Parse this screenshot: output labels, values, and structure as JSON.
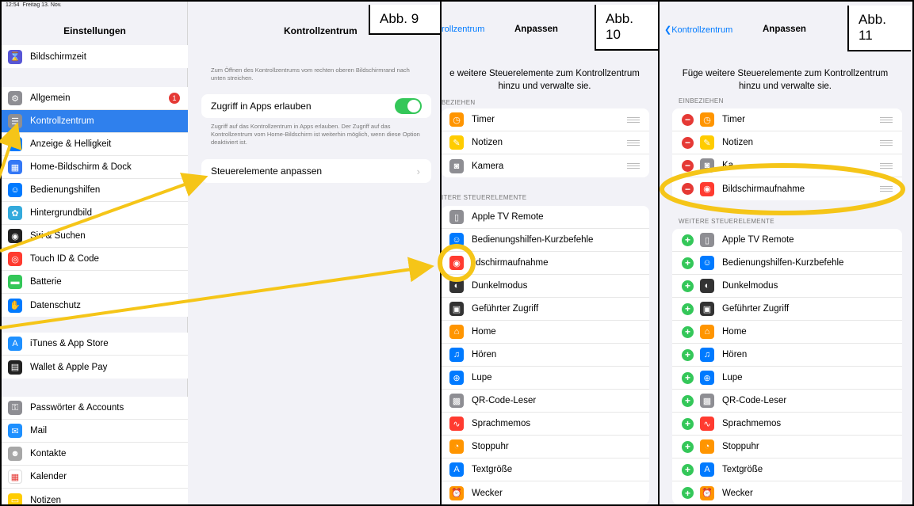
{
  "panel1": {
    "label": "Abb. 9",
    "status_time": "12:54",
    "status_date": "Freitag 13. Nov.",
    "sidebar_title": "Einstellungen",
    "groups": [
      [
        {
          "label": "Bildschirmzeit",
          "icon": "hourglass-icon",
          "color": "#5856d6",
          "glyph": "⌛"
        }
      ],
      [
        {
          "label": "Allgemein",
          "icon": "gear-icon",
          "color": "#8e8e93",
          "glyph": "⚙",
          "badge": "1"
        },
        {
          "label": "Kontrollzentrum",
          "icon": "switches-icon",
          "color": "#8e8e93",
          "glyph": "☰",
          "selected": true
        },
        {
          "label": "Anzeige & Helligkeit",
          "icon": "text-size-icon",
          "color": "#007aff",
          "glyph": "A"
        },
        {
          "label": "Home-Bildschirm & Dock",
          "icon": "grid-icon",
          "color": "#3478f6",
          "glyph": "▦"
        },
        {
          "label": "Bedienungshilfen",
          "icon": "accessibility-icon",
          "color": "#007aff",
          "glyph": "☺"
        },
        {
          "label": "Hintergrundbild",
          "icon": "flower-icon",
          "color": "#34aadc",
          "glyph": "✿"
        },
        {
          "label": "Siri & Suchen",
          "icon": "siri-icon",
          "color": "#222222",
          "glyph": "◉"
        },
        {
          "label": "Touch ID & Code",
          "icon": "fingerprint-icon",
          "color": "#ff3b30",
          "glyph": "◎"
        },
        {
          "label": "Batterie",
          "icon": "battery-icon",
          "color": "#34c759",
          "glyph": "▬"
        },
        {
          "label": "Datenschutz",
          "icon": "hand-icon",
          "color": "#007aff",
          "glyph": "✋"
        }
      ],
      [
        {
          "label": "iTunes & App Store",
          "icon": "app-store-icon",
          "color": "#1e90ff",
          "glyph": "A"
        },
        {
          "label": "Wallet & Apple Pay",
          "icon": "wallet-icon",
          "color": "#222222",
          "glyph": "▤"
        }
      ],
      [
        {
          "label": "Passwörter & Accounts",
          "icon": "key-icon",
          "color": "#8e8e93",
          "glyph": "⚿"
        },
        {
          "label": "Mail",
          "icon": "mail-icon",
          "color": "#1e90ff",
          "glyph": "✉"
        },
        {
          "label": "Kontakte",
          "icon": "contacts-icon",
          "color": "#a7a7a7",
          "glyph": "☻"
        },
        {
          "label": "Kalender",
          "icon": "calendar-icon",
          "color": "#ffffff",
          "glyph": "▦"
        },
        {
          "label": "Notizen",
          "icon": "notes-icon",
          "color": "#ffcc00",
          "glyph": "▭"
        }
      ]
    ],
    "detail": {
      "title": "Kontrollzentrum",
      "hint1": "Zum Öffnen des Kontrollzentrums vom rechten oberen Bildschirmrand nach unten streichen.",
      "toggle_label": "Zugriff in Apps erlauben",
      "toggle_on": true,
      "hint2": "Zugriff auf das Kontrollzentrum in Apps erlauben. Der Zugriff auf das Kontrollzentrum vom Home-Bildschirm ist weiterhin möglich, wenn diese Option deaktiviert ist.",
      "customize_label": "Steuerelemente anpassen"
    }
  },
  "panel2": {
    "label": "Abb. 10",
    "back": "rollzentrum",
    "title": "Anpassen",
    "intro": "e weitere Steuerelemente zum Kontrollzentrum\nhinzu und verwalte sie.",
    "section_included": "BEZIEHEN",
    "included": [
      {
        "label": "Timer",
        "icon": "timer-icon",
        "color": "#ff9500",
        "glyph": "◷"
      },
      {
        "label": "Notizen",
        "icon": "notes-icon",
        "color": "#ffcc00",
        "glyph": "✎"
      },
      {
        "label": "Kamera",
        "icon": "camera-icon",
        "color": "#8e8e93",
        "glyph": "◙"
      }
    ],
    "section_more": "ITERE STEUERELEMENTE",
    "more": [
      {
        "label": "Apple TV Remote",
        "icon": "remote-icon",
        "color": "#8e8e93",
        "glyph": "▯"
      },
      {
        "label": "Bedienungshilfen-Kurzbefehle",
        "icon": "accessibility-icon",
        "color": "#007aff",
        "glyph": "☺"
      },
      {
        "label": "ildschirmaufnahme",
        "icon": "screen-record-icon",
        "color": "#ff3b30",
        "glyph": "◉"
      },
      {
        "label": "Dunkelmodus",
        "icon": "dark-mode-icon",
        "color": "#333333",
        "glyph": "◐"
      },
      {
        "label": "Geführter Zugriff",
        "icon": "lock-icon",
        "color": "#333333",
        "glyph": "▣"
      },
      {
        "label": "Home",
        "icon": "home-icon",
        "color": "#ff9500",
        "glyph": "⌂"
      },
      {
        "label": "Hören",
        "icon": "ear-icon",
        "color": "#007aff",
        "glyph": "♫"
      },
      {
        "label": "Lupe",
        "icon": "magnifier-icon",
        "color": "#007aff",
        "glyph": "⊕"
      },
      {
        "label": "QR-Code-Leser",
        "icon": "qr-icon",
        "color": "#8e8e93",
        "glyph": "▩"
      },
      {
        "label": "Sprachmemos",
        "icon": "waveform-icon",
        "color": "#ff3b30",
        "glyph": "∿"
      },
      {
        "label": "Stoppuhr",
        "icon": "stopwatch-icon",
        "color": "#ff9500",
        "glyph": "◔"
      },
      {
        "label": "Textgröße",
        "icon": "text-size-icon",
        "color": "#007aff",
        "glyph": "A"
      },
      {
        "label": "Wecker",
        "icon": "alarm-icon",
        "color": "#ff9500",
        "glyph": "⏰"
      }
    ]
  },
  "panel3": {
    "label": "Abb. 11",
    "back": "Kontrollzentrum",
    "title": "Anpassen",
    "intro": "Füge weitere Steuerelemente zum Kontrollzentrum\nhinzu und verwalte sie.",
    "section_included": "EINBEZIEHEN",
    "included": [
      {
        "label": "Timer",
        "icon": "timer-icon",
        "color": "#ff9500",
        "glyph": "◷"
      },
      {
        "label": "Notizen",
        "icon": "notes-icon",
        "color": "#ffcc00",
        "glyph": "✎"
      },
      {
        "label": "Ka",
        "icon": "camera-icon",
        "color": "#8e8e93",
        "glyph": "◙"
      },
      {
        "label": "Bildschirmaufnahme",
        "icon": "screen-record-icon",
        "color": "#ff3b30",
        "glyph": "◉"
      }
    ],
    "section_more": "WEITERE STEUERELEMENTE",
    "more": [
      {
        "label": "Apple TV Remote",
        "icon": "remote-icon",
        "color": "#8e8e93",
        "glyph": "▯"
      },
      {
        "label": "Bedienungshilfen-Kurzbefehle",
        "icon": "accessibility-icon",
        "color": "#007aff",
        "glyph": "☺"
      },
      {
        "label": "Dunkelmodus",
        "icon": "dark-mode-icon",
        "color": "#333333",
        "glyph": "◐"
      },
      {
        "label": "Geführter Zugriff",
        "icon": "lock-icon",
        "color": "#333333",
        "glyph": "▣"
      },
      {
        "label": "Home",
        "icon": "home-icon",
        "color": "#ff9500",
        "glyph": "⌂"
      },
      {
        "label": "Hören",
        "icon": "ear-icon",
        "color": "#007aff",
        "glyph": "♫"
      },
      {
        "label": "Lupe",
        "icon": "magnifier-icon",
        "color": "#007aff",
        "glyph": "⊕"
      },
      {
        "label": "QR-Code-Leser",
        "icon": "qr-icon",
        "color": "#8e8e93",
        "glyph": "▩"
      },
      {
        "label": "Sprachmemos",
        "icon": "waveform-icon",
        "color": "#ff3b30",
        "glyph": "∿"
      },
      {
        "label": "Stoppuhr",
        "icon": "stopwatch-icon",
        "color": "#ff9500",
        "glyph": "◔"
      },
      {
        "label": "Textgröße",
        "icon": "text-size-icon",
        "color": "#007aff",
        "glyph": "A"
      },
      {
        "label": "Wecker",
        "icon": "alarm-icon",
        "color": "#ff9500",
        "glyph": "⏰"
      }
    ]
  },
  "annotation_color": "#f5c518"
}
